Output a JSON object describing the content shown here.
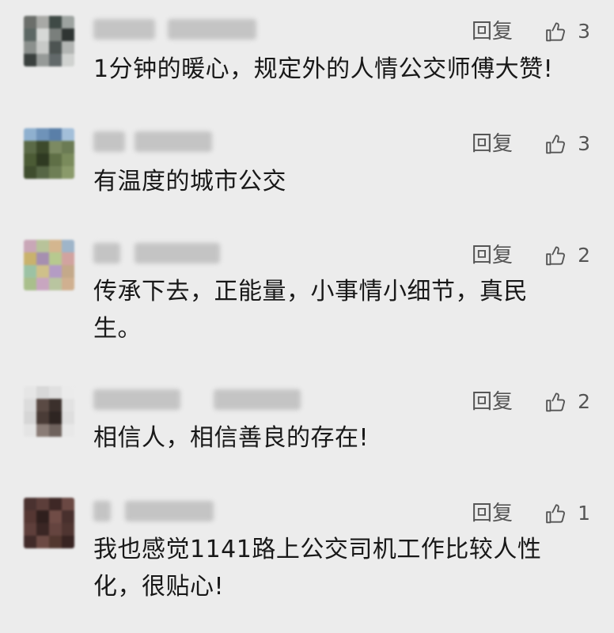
{
  "comments": [
    {
      "reply_label": "回复",
      "likes": "3",
      "text": "1分钟的暖心，规定外的人情公交师傅大赞!",
      "avatar_colors": [
        "#6b6e6a",
        "#a8a9a6",
        "#3f4a46",
        "#9da3a0",
        "#5c6764",
        "#d6d8d6",
        "#7a7f7c",
        "#2f3533",
        "#8b908d",
        "#c7c9c7",
        "#4d5452",
        "#b2b5b3",
        "#3a403e",
        "#969a98",
        "#62696a",
        "#d0d2d0"
      ]
    },
    {
      "reply_label": "回复",
      "likes": "3",
      "text": "有温度的城市公交",
      "avatar_colors": [
        "#8fb0cf",
        "#6f93b9",
        "#5a7fa8",
        "#a3bfd9",
        "#5b6a47",
        "#3d4a2c",
        "#7c8a62",
        "#6b7b54",
        "#4b5b35",
        "#2f3a22",
        "#5f6f46",
        "#7a8b5c",
        "#3f4d2e",
        "#566645",
        "#6e7e55",
        "#8a9a6a"
      ]
    },
    {
      "reply_label": "回复",
      "likes": "2",
      "text": "传承下去，正能量，小事情小细节，真民生。",
      "avatar_colors": [
        "#c9a7b7",
        "#b8c39a",
        "#d4b68f",
        "#9fb5c9",
        "#c9b26d",
        "#a68fb0",
        "#b7c98f",
        "#d1a3a0",
        "#9cc2a4",
        "#cfc08a",
        "#b49cc4",
        "#c4a98a",
        "#a9bf8c",
        "#c8a6c0",
        "#b9c5a0",
        "#d0b090"
      ]
    },
    {
      "reply_label": "回复",
      "likes": "2",
      "text": "相信人，相信善良的存在!",
      "avatar_colors": [
        "#e6e6e6",
        "#d8d8d8",
        "#e0e0e0",
        "#ebebeb",
        "#dcdcdc",
        "#5a4a44",
        "#3b302c",
        "#e2e2e2",
        "#d6d6d6",
        "#4a3c37",
        "#2e2522",
        "#dedede",
        "#e4e4e4",
        "#8a7c76",
        "#6e625d",
        "#e8e8e8"
      ]
    },
    {
      "reply_label": "回复",
      "likes": "1",
      "text": "我也感觉1141路上公交司机工作比较人性化，很贴心!",
      "avatar_colors": [
        "#4a3230",
        "#5c3e3a",
        "#3e2826",
        "#6a4843",
        "#553733",
        "#2f1f1d",
        "#704c46",
        "#48302d",
        "#5e3f3b",
        "#3a2624",
        "#65443f",
        "#4f3531",
        "#412b29",
        "#6c4a44",
        "#52372f",
        "#382422"
      ]
    }
  ]
}
